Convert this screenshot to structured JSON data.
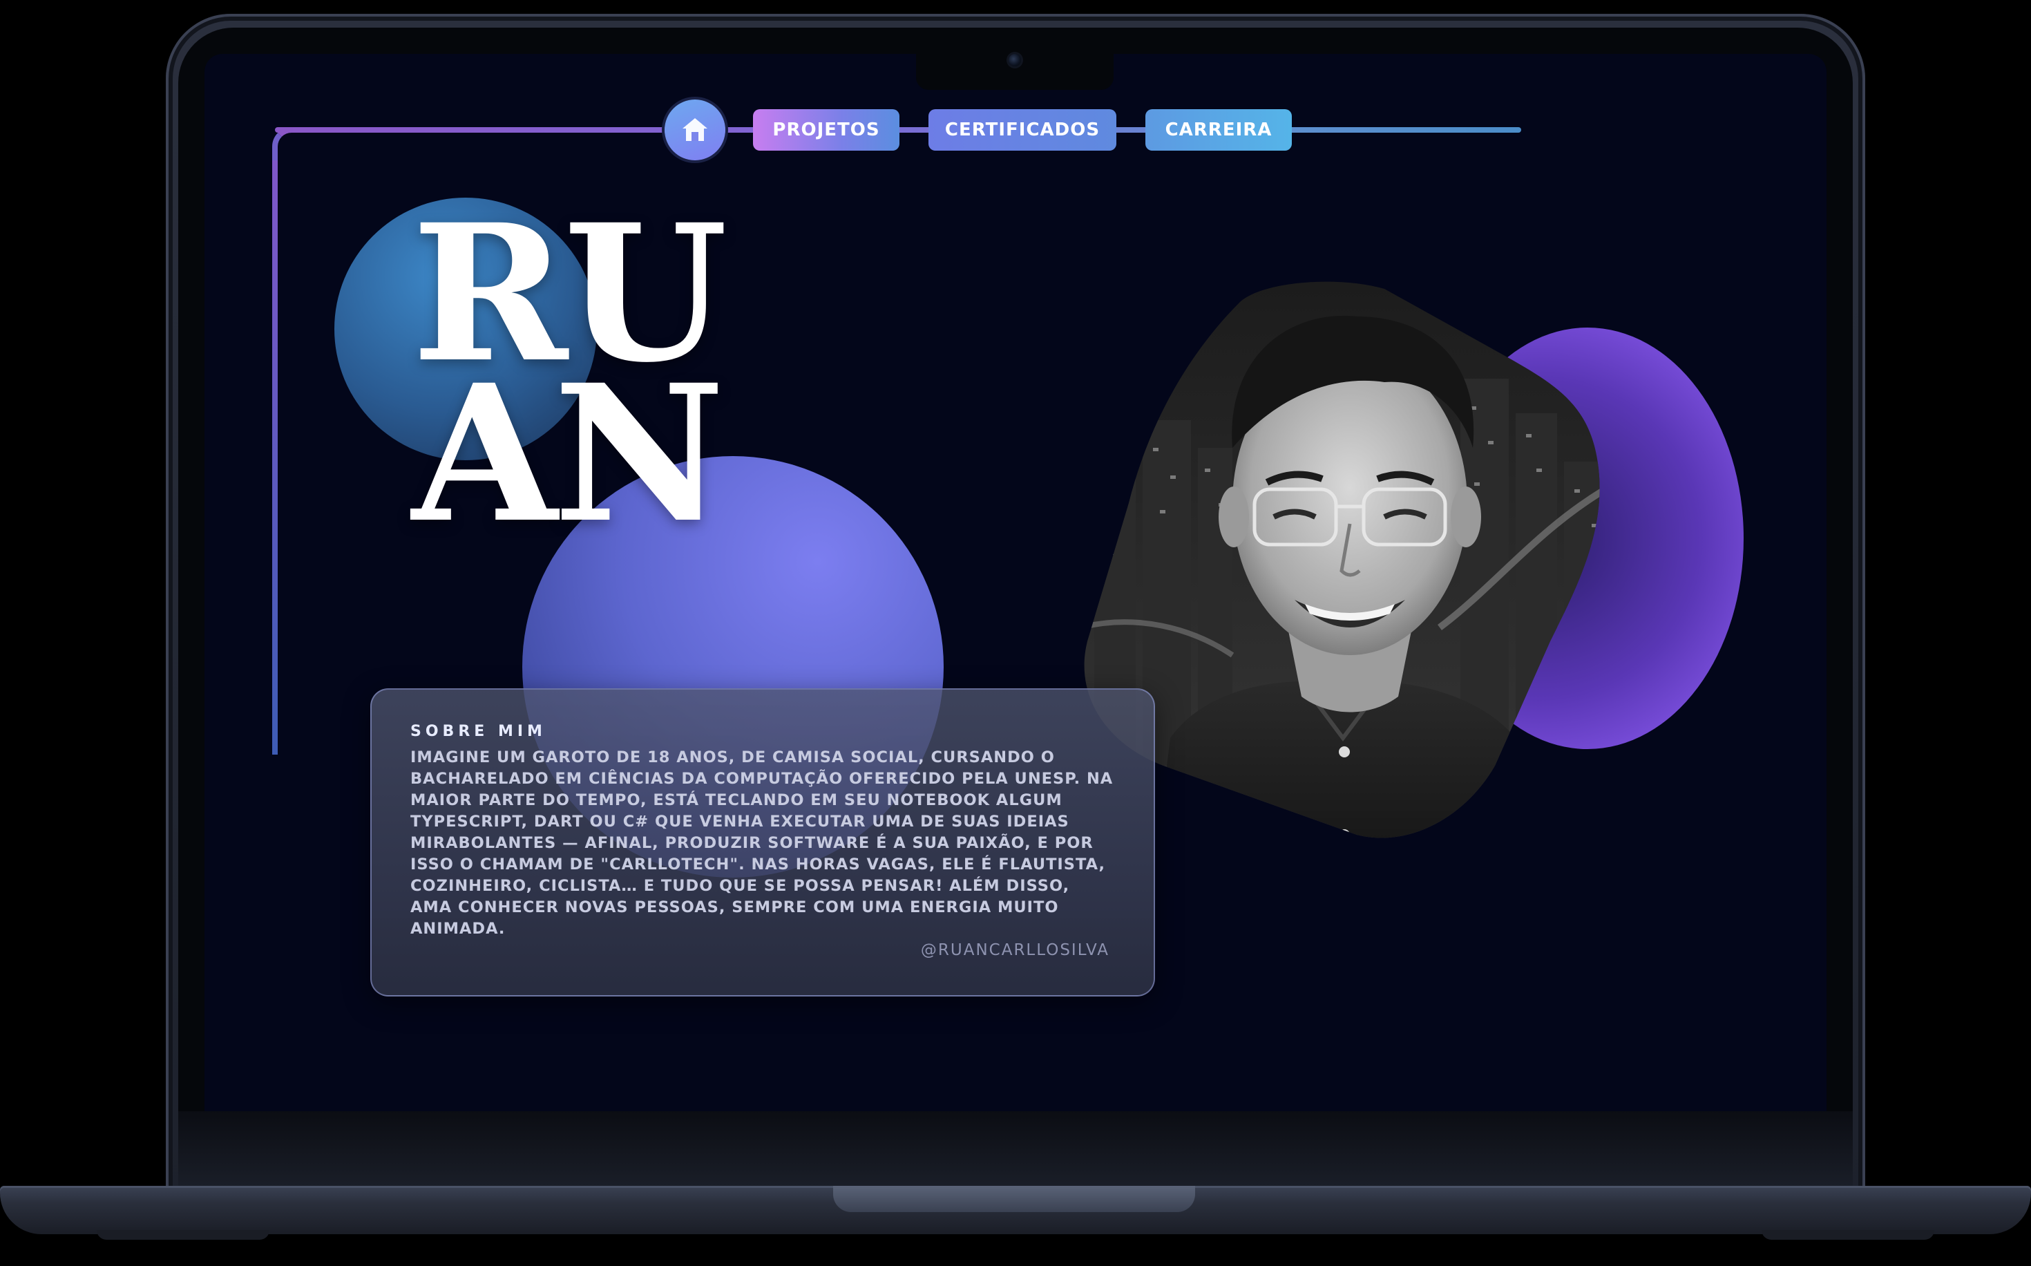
{
  "nav": {
    "home_icon": "home-icon",
    "projetos": "PROJETOS",
    "certificados": "CERTIFICADOS",
    "carreira": "CARREIRA"
  },
  "hero": {
    "name_line1": "RU",
    "name_line2": "AN"
  },
  "about": {
    "title": "SOBRE MIM",
    "text": "IMAGINE UM GAROTO DE 18 ANOS, DE CAMISA SOCIAL, CURSANDO O BACHARELADO EM CIÊNCIAS DA COMPUTAÇÃO OFERECIDO PELA UNESP. NA MAIOR PARTE DO TEMPO, ESTÁ TECLANDO EM SEU NOTEBOOK ALGUM TYPESCRIPT, DART OU C# QUE VENHA EXECUTAR UMA DE SUAS IDEIAS MIRABOLANTES — AFINAL, PRODUZIR SOFTWARE É A SUA PAIXÃO, E POR ISSO O CHAMAM DE \"CARLLOTECH\". NAS HORAS VAGAS, ELE É FLAUTISTA, COZINHEIRO, CICLISTA… E TUDO QUE SE POSSA PENSAR! ALÉM DISSO, AMA CONHECER NOVAS PESSOAS, SEMPRE COM UMA ENERGIA MUITO ANIMADA.",
    "handle": "@RUANCARLLOSILVA"
  },
  "photo": {
    "subject": "portrait-photo",
    "style": "black-and-white"
  },
  "colors": {
    "background": "#03061a",
    "accent_purple": "#7b80e8",
    "accent_blue": "#55b4e8",
    "accent_pink": "#c77ef0"
  }
}
